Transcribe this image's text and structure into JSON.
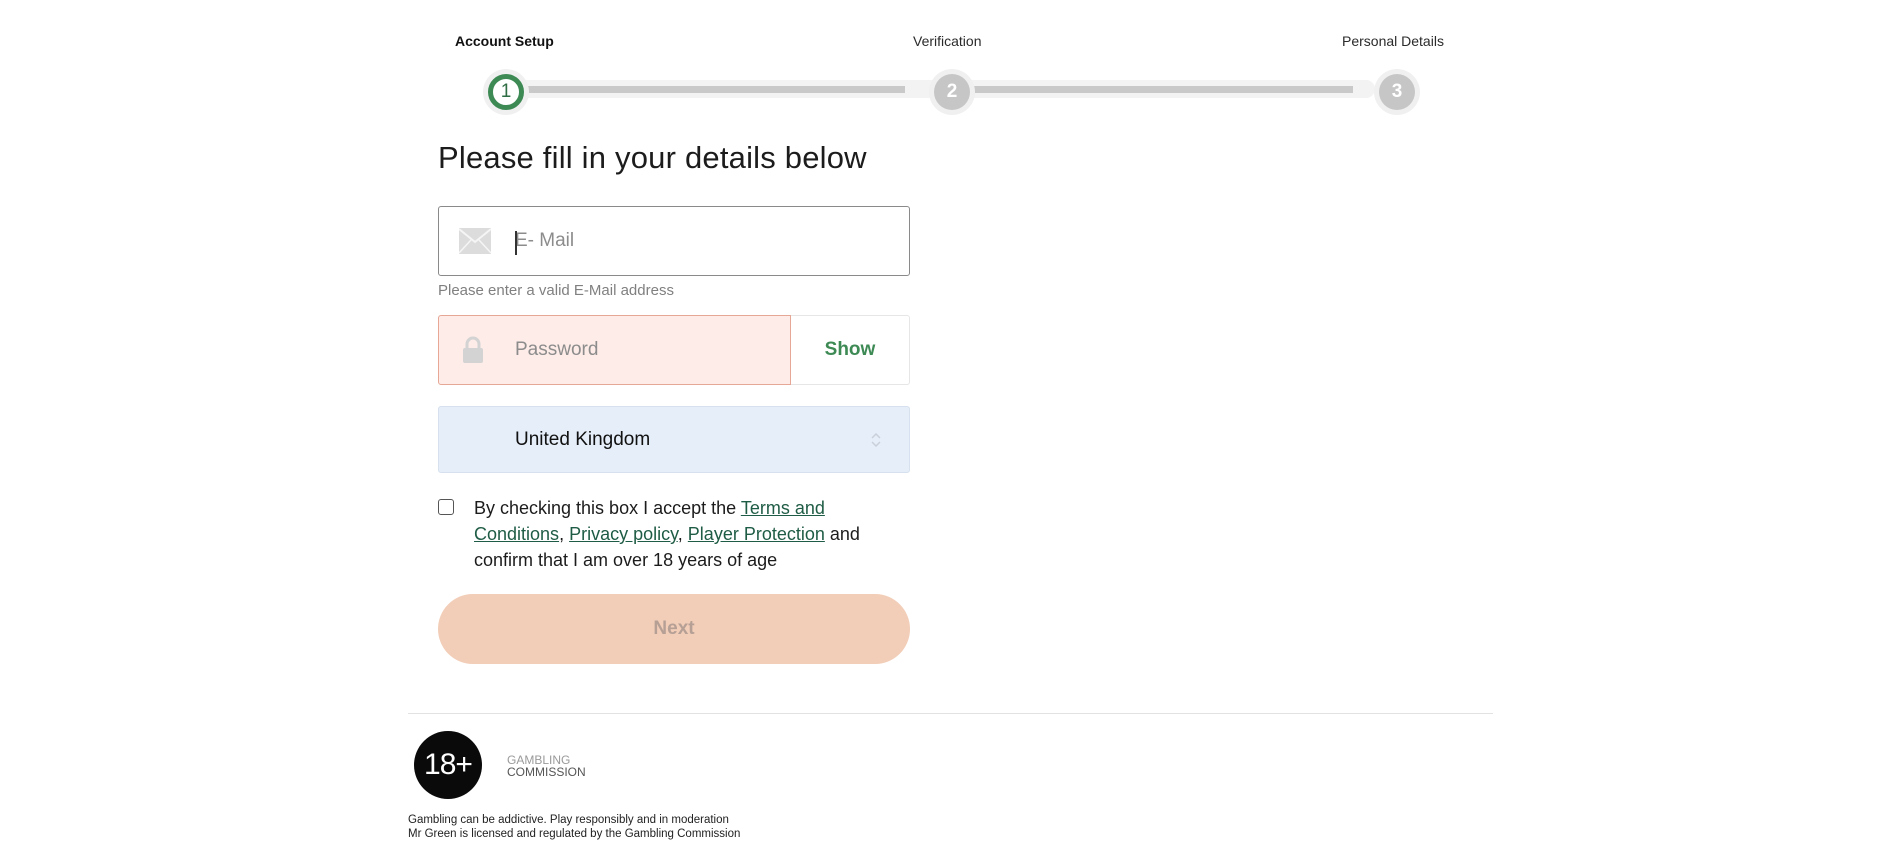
{
  "stepper": {
    "steps": [
      {
        "label": "Account Setup",
        "number": "1",
        "state": "active"
      },
      {
        "label": "Verification",
        "number": "2",
        "state": "inactive"
      },
      {
        "label": "Personal Details",
        "number": "3",
        "state": "inactive"
      }
    ]
  },
  "form": {
    "heading": "Please fill in your details below",
    "email": {
      "placeholder": "E- Mail",
      "value": "",
      "icon": "envelope-icon",
      "hint": "Please enter a valid E-Mail address"
    },
    "password": {
      "placeholder": "Password",
      "value": "",
      "icon": "lock-icon",
      "show_label": "Show"
    },
    "country": {
      "selected": "United Kingdom",
      "icon": "updown-chevron-icon"
    },
    "consent": {
      "checked": false,
      "text_before": "By checking this box I accept the ",
      "link_terms": "Terms and Conditions",
      "sep1": ", ",
      "link_privacy": "Privacy policy",
      "sep2": ", ",
      "link_player": "Player Protection",
      "text_after": " and confirm that I am over 18 years of age"
    },
    "next_label": "Next"
  },
  "colors": {
    "accent_green": "#3e8a55",
    "error_bg": "#fdece8",
    "error_border": "#e7a797",
    "select_bg": "#e6eef9",
    "next_disabled_bg": "#f2cdb7"
  },
  "footer": {
    "age_badge": "18+",
    "gc_line1": "GAMBLING",
    "gc_line2": "COMMISSION",
    "line1": "Gambling can be addictive. Play responsibly and in moderation",
    "line2": "Mr Green is licensed and regulated by the Gambling Commission"
  }
}
